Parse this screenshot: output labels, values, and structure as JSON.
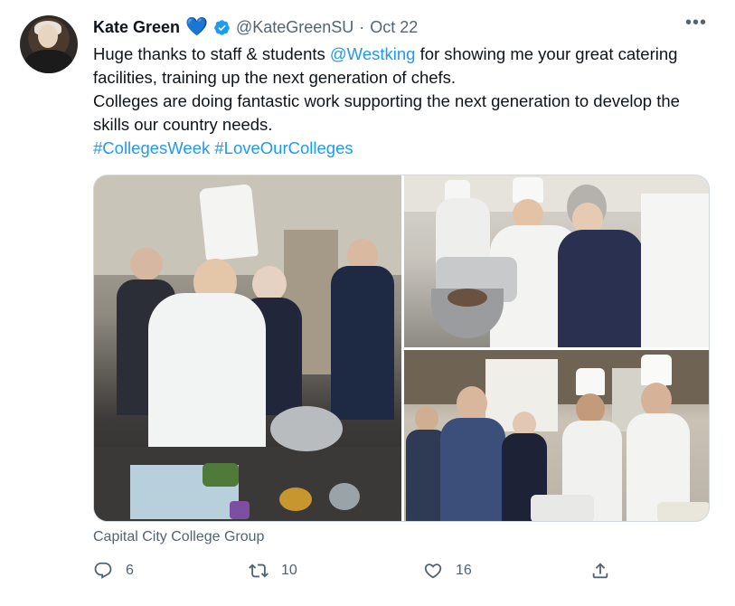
{
  "tweet": {
    "author_name": "Kate Green",
    "author_handle": "@KateGreenSU",
    "separator": "·",
    "date": "Oct 22",
    "more_label": "•••",
    "line1_pre": "Huge thanks to staff & students ",
    "mention": "@Westking",
    "line1_post": " for showing me your great catering facilities, training up the next generation of chefs.",
    "line2": "Colleges are doing fantastic work supporting the next generation to develop the skills our country needs.",
    "hashtag1": "#CollegesWeek",
    "hashtag2": "#LoveOurColleges",
    "media_source": "Capital City College Group",
    "replies": "6",
    "retweets": "10",
    "likes": "16"
  },
  "colors": {
    "link": "#1d9bf0",
    "secondary_text": "#536471",
    "heart_emoji": "#5ba4e6"
  },
  "icons": [
    "heart-emoji-icon",
    "verified-badge-icon",
    "more-icon",
    "reply-icon",
    "retweet-icon",
    "like-icon",
    "share-icon"
  ]
}
